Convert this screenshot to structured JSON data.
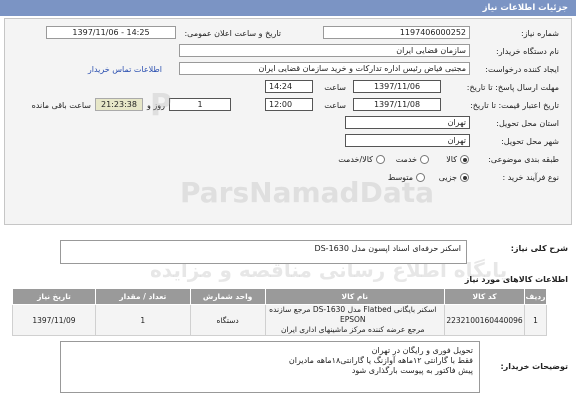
{
  "title": "جزئیات اطلاعات نیاز",
  "need_number": {
    "label": "شماره نیاز:",
    "value": "1197406000252"
  },
  "announce": {
    "label": "تاریخ و ساعت اعلان عمومی:",
    "value": "1397/11/06 - 14:25"
  },
  "buyer": {
    "label": "نام دستگاه خریدار:",
    "value": "سازمان قضایی ایران"
  },
  "requester": {
    "label": "ایجاد کننده درخواست:",
    "value": "مجتبی  فیاض رئیس اداره تدارکات و خرید سازمان قضایی ایران"
  },
  "contact_link": "اطلاعات تماس خریدار",
  "deadline": {
    "label": "مهلت ارسال پاسخ: تا تاریخ:",
    "date": "1397/11/06",
    "time_label": "ساعت",
    "time": "14:24"
  },
  "validity": {
    "label": "تاریخ اعتبار قیمت: تا تاریخ:",
    "date": "1397/11/08",
    "time_label": "ساعت",
    "time": "12:00",
    "days": "1",
    "days_label": "روز و",
    "remaining": "21:23:38",
    "remaining_label": "ساعت باقی مانده"
  },
  "province": {
    "label": "استان محل تحویل:",
    "value": "تهران"
  },
  "city": {
    "label": "شهر محل تحویل:",
    "value": "تهران"
  },
  "category": {
    "label": "طبقه بندی موضوعی:",
    "options": [
      "کالا",
      "خدمت",
      "کالا/خدمت"
    ],
    "selected": "کالا"
  },
  "process": {
    "label": "نوع فرآیند خرید :",
    "options": [
      "جزیی",
      "متوسط"
    ],
    "selected": "جزیی"
  },
  "description": {
    "label": "شرح کلی نیاز:",
    "value": "اسکنر حرفه‌ای اسناد اپسون مدل DS-1630"
  },
  "goods_header": "اطلاعات کالاهای مورد نیاز",
  "table": {
    "columns": [
      "ردیف",
      "کد کالا",
      "نام کالا",
      "واحد شمارش",
      "تعداد / مقدار",
      "تاریخ نیاز"
    ],
    "rows": [
      {
        "row": "1",
        "code": "2232100160440096",
        "name_line1": "اسکنر بایگانی Flatbed مدل DS-1630 مرجع سازنده EPSON",
        "name_line2": "مرجع عرضه کننده مرکز ماشینهای اداری ایران",
        "unit": "دستگاه",
        "qty": "1",
        "date": "1397/11/09"
      }
    ]
  },
  "notes": {
    "label": "توضیحات خریدار:",
    "lines": [
      "تحویل فوری و رایگان در تهران",
      "فقط با گارانتی ۱۲ماهه آوازنگ یا گارانتی۱۸ماهه مادیران",
      "پیش فاکتور به پیوست بارگذاری شود"
    ]
  },
  "watermark": {
    "brand": "ParsNamadData",
    "site": "پایگاه اطلاع رسانی مناقصه و مزایده"
  }
}
